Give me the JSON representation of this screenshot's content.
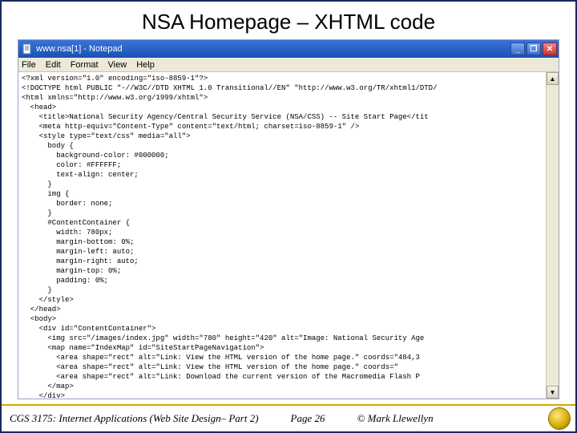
{
  "slide": {
    "title": "NSA Homepage – XHTML code"
  },
  "notepad": {
    "window_title": "www.nsa[1] - Notepad",
    "menu": {
      "file": "File",
      "edit": "Edit",
      "format": "Format",
      "view": "View",
      "help": "Help"
    },
    "content": "<?xml version=\"1.0\" encoding=\"iso-8859-1\"?>\n<!DOCTYPE html PUBLIC \"-//W3C//DTD XHTML 1.0 Transitional//EN\" \"http://www.w3.org/TR/xhtml1/DTD/\n<html xmlns=\"http://www.w3.org/1999/xhtml\">\n  <head>\n    <title>National Security Agency/Central Security Service (NSA/CSS) -- Site Start Page</tit\n    <meta http-equiv=\"Content-Type\" content=\"text/html; charset=iso-8859-1\" />\n    <style type=\"text/css\" media=\"all\">\n      body {\n        background-color: #000000;\n        color: #FFFFFF;\n        text-align: center;\n      }\n      img {\n        border: none;\n      }\n      #ContentContainer {\n        width: 780px;\n        margin-bottom: 0%;\n        margin-left: auto;\n        margin-right: auto;\n        margin-top: 0%;\n        padding: 0%;\n      }\n    </style>\n  </head>\n  <body>\n    <div id=\"ContentContainer\">\n      <img src=\"/images/index.jpg\" width=\"780\" height=\"420\" alt=\"Image: National Security Age\n      <map name=\"IndexMap\" id=\"SiteStartPageNavigation\">\n        <area shape=\"rect\" alt=\"Link: View the HTML version of the home page.\" coords=\"484,3\n        <area shape=\"rect\" alt=\"Link: View the HTML version of the home page.\" coords=\"\n        <area shape=\"rect\" alt=\"Link: Download the current version of the Macromedia Flash P\n      </map>\n    </div>\n  </body>\n</html>"
  },
  "footer": {
    "course": "CGS 3175: Internet Applications (Web Site Design– Part 2)",
    "page": "Page 26",
    "copyright": "© Mark Llewellyn"
  }
}
